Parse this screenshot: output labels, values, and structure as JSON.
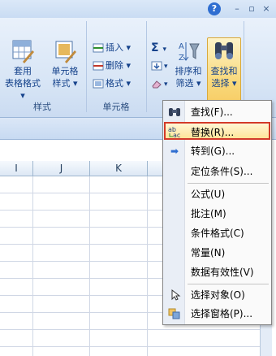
{
  "window_controls": {
    "help": "?",
    "minimize": "–",
    "restore": "▫",
    "close": "×"
  },
  "ribbon": {
    "styles_group": {
      "label": "样式",
      "table_format": {
        "line1": "套用",
        "line2": "表格格式 ▾"
      },
      "cell_style": {
        "line1": "单元格",
        "line2": "样式 ▾"
      }
    },
    "cells_group": {
      "label": "单元格",
      "insert": "插入 ▾",
      "delete": "删除 ▾",
      "format": "格式 ▾"
    },
    "editing_group": {
      "sum_symbol": "Σ",
      "sort": {
        "line1": "排序和",
        "line2": "筛选 ▾"
      },
      "find": {
        "line1": "查找和",
        "line2": "选择 ▾"
      }
    }
  },
  "grid": {
    "columns": [
      "I",
      "J",
      "K"
    ]
  },
  "menu": {
    "items": [
      {
        "label": "查找(F)...",
        "icon": "binoculars-icon"
      },
      {
        "label": "替换(R)...",
        "icon": "replace-icon"
      },
      {
        "label": "转到(G)...",
        "icon": "arrow-right-icon"
      },
      {
        "label": "定位条件(S)...",
        "icon": ""
      },
      {
        "label": "公式(U)",
        "icon": ""
      },
      {
        "label": "批注(M)",
        "icon": ""
      },
      {
        "label": "条件格式(C)",
        "icon": ""
      },
      {
        "label": "常量(N)",
        "icon": ""
      },
      {
        "label": "数据有效性(V)",
        "icon": ""
      },
      {
        "label": "选择对象(O)",
        "icon": "cursor-icon"
      },
      {
        "label": "选择窗格(P)...",
        "icon": "selection-pane-icon"
      }
    ],
    "highlighted_index": 1
  },
  "colors": {
    "highlight_border": "#d33a2a",
    "ribbon_bg": "#d6e4f5"
  }
}
